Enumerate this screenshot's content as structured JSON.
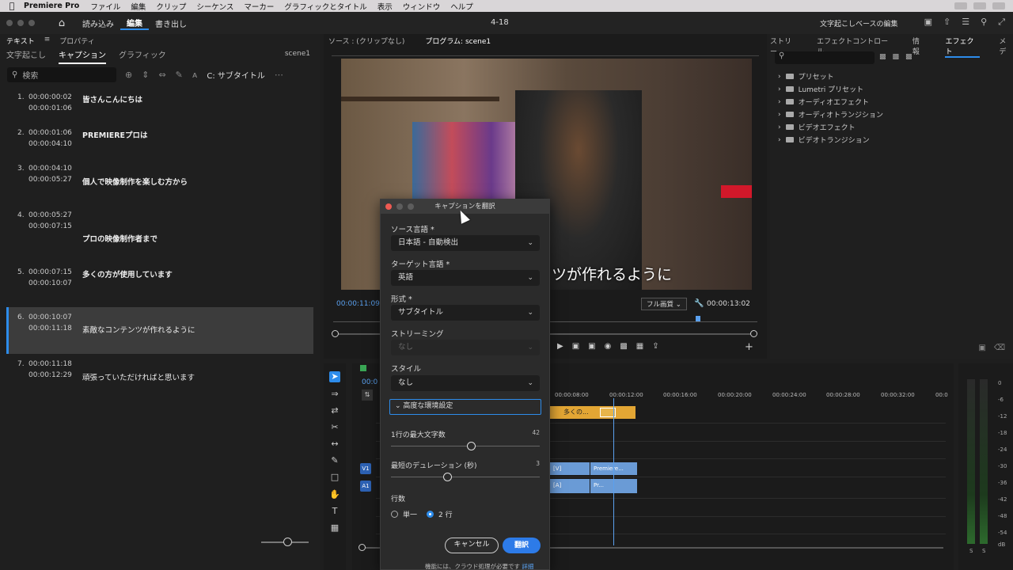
{
  "menubar": {
    "app": "Premiere Pro",
    "items": [
      "ファイル",
      "編集",
      "クリップ",
      "シーケンス",
      "マーカー",
      "グラフィックとタイトル",
      "表示",
      "ウィンドウ",
      "ヘルプ"
    ]
  },
  "header": {
    "nav": [
      "読み込み",
      "編集",
      "書き出し"
    ],
    "active_nav": "編集",
    "document": "4-18",
    "workspace": "文字起こしベースの編集"
  },
  "left_panel": {
    "tabs": [
      "テキスト",
      "プロパティ"
    ],
    "subtabs": [
      "文字起こし",
      "キャプション",
      "グラフィック"
    ],
    "active_subtab": "キャプション",
    "scene": "scene1",
    "search_placeholder": "検索",
    "caption_track": "C: サブタイトル",
    "captions": [
      {
        "num": "1.",
        "in": "00:00:00:02",
        "out": "00:00:01:06",
        "text": "皆さんこんにちは"
      },
      {
        "num": "2.",
        "in": "00:00:01:06",
        "out": "00:00:04:10",
        "text": "PREMIEREプロは"
      },
      {
        "num": "3.",
        "in": "00:00:04:10",
        "out": "00:00:05:27",
        "text": "個人で映像制作を楽しむ方から"
      },
      {
        "num": "4.",
        "in": "00:00:05:27",
        "out": "00:00:07:15",
        "text": "プロの映像制作者まで"
      },
      {
        "num": "5.",
        "in": "00:00:07:15",
        "out": "00:00:10:07",
        "text": "多くの方が使用しています"
      },
      {
        "num": "6.",
        "in": "00:00:10:07",
        "out": "00:00:11:18",
        "text": "素敵なコンテンツが作れるように"
      },
      {
        "num": "7.",
        "in": "00:00:11:18",
        "out": "00:00:12:29",
        "text": "頑張っていただければと思います"
      }
    ]
  },
  "monitor": {
    "source_tab": "ソース : (クリップなし)",
    "program_tab": "プログラム: scene1",
    "subtitle": "ツが作れるように",
    "timecode_current": "00:00:11:09",
    "quality": "フル画質",
    "timecode_duration": "00:00:13:02"
  },
  "effects": {
    "tabs": [
      "ストリー",
      "エフェクトコントロール",
      "情報",
      "エフェクト",
      "メデ"
    ],
    "active_tab": "エフェクト",
    "items": [
      "プリセット",
      "Lumetri プリセット",
      "オーディオエフェクト",
      "オーディオトランジション",
      "ビデオエフェクト",
      "ビデオトランジション"
    ]
  },
  "timeline": {
    "timecode": "00:0",
    "ruler": [
      "00:00:08:00",
      "00:00:12:00",
      "00:00:16:00",
      "00:00:20:00",
      "00:00:24:00",
      "00:00:28:00",
      "00:00:32:00",
      "00:0"
    ],
    "caption_clip": "多くの...",
    "video_clip": "Premiere...",
    "audio_clip": "Pr...",
    "tracks": [
      "V1",
      "A1"
    ]
  },
  "meters": {
    "labels": [
      "0",
      "-6",
      "-12",
      "-18",
      "-24",
      "-30",
      "-36",
      "-42",
      "-48",
      "-54",
      "dB"
    ],
    "channels": [
      "S",
      "S"
    ]
  },
  "dialog": {
    "title": "キャプションを翻訳",
    "source_label": "ソース言語 *",
    "source_value": "日本語 - 自動検出",
    "target_label": "ターゲット言語 *",
    "target_value": "英語",
    "format_label": "形式 *",
    "format_value": "サブタイトル",
    "streaming_label": "ストリーミング",
    "streaming_value": "なし",
    "style_label": "スタイル",
    "style_value": "なし",
    "advanced_label": "高度な環境設定",
    "max_chars_label": "1行の最大文字数",
    "max_chars_value": 42,
    "min_duration_label": "最短のデュレーション (秒)",
    "min_duration_value": 3,
    "lines_label": "行数",
    "line_single": "単一",
    "line_double": "2 行",
    "cancel": "キャンセル",
    "translate": "翻訳",
    "note": "機能には、クラウド処理が必要です",
    "note_link": "詳細"
  }
}
